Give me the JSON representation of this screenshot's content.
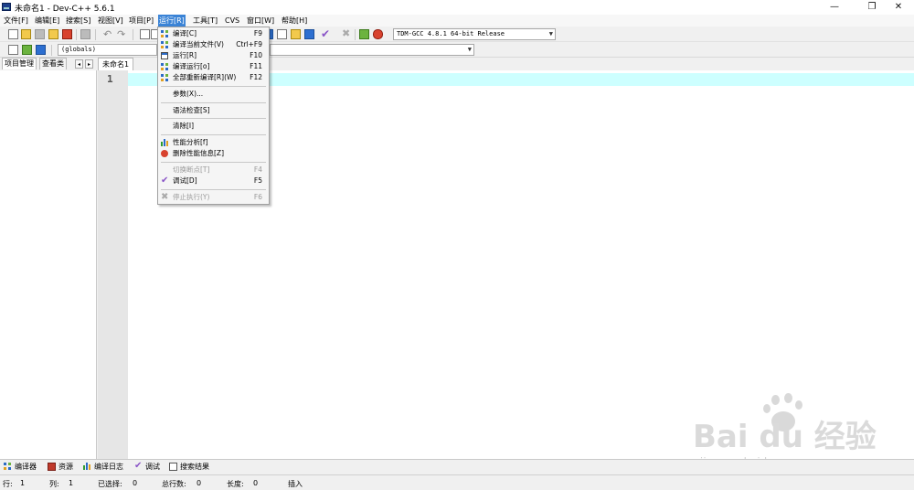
{
  "window": {
    "title": "未命名1 - Dev-C++ 5.6.1",
    "minimize": "—",
    "maximize": "❐",
    "close": "✕"
  },
  "menubar": [
    "文件[F]",
    "编辑[E]",
    "搜索[S]",
    "视图[V]",
    "项目[P]",
    "运行[R]",
    "工具[T]",
    "CVS",
    "窗口[W]",
    "帮助[H]"
  ],
  "toolbar": {
    "compiler_select": "TDM-GCC 4.8.1 64-bit Release",
    "scope_select": "(globals)"
  },
  "left_panel": {
    "tabs": [
      "项目管理",
      "查看类"
    ],
    "prev": "◂",
    "next": "▸"
  },
  "editor": {
    "tab": "未命名1",
    "line_number": "1"
  },
  "run_menu": {
    "items": [
      {
        "label": "编译[C]",
        "shortcut": "F9",
        "icon": "grid-icon",
        "enabled": true
      },
      {
        "label": "编译当前文件(V)",
        "shortcut": "Ctrl+F9",
        "icon": "grid-icon",
        "enabled": true
      },
      {
        "label": "运行[R]",
        "shortcut": "F10",
        "icon": "window-icon",
        "enabled": true
      },
      {
        "label": "编译运行[o]",
        "shortcut": "F11",
        "icon": "window-grid-icon",
        "enabled": true
      },
      {
        "label": "全部重新编译[R](W)",
        "shortcut": "F12",
        "icon": "grid-icon",
        "enabled": true
      },
      {
        "label": "参数(X)...",
        "shortcut": "",
        "icon": "",
        "enabled": true
      },
      {
        "label": "语法检查[S]",
        "shortcut": "",
        "icon": "",
        "enabled": true
      },
      {
        "label": "清除[I]",
        "shortcut": "",
        "icon": "",
        "enabled": true
      },
      {
        "label": "性能分析[f]",
        "shortcut": "",
        "icon": "chart-icon",
        "enabled": true
      },
      {
        "label": "删除性能信息[Z]",
        "shortcut": "",
        "icon": "bug-icon",
        "enabled": true
      },
      {
        "label": "切换断点[T]",
        "shortcut": "F4",
        "icon": "",
        "enabled": false
      },
      {
        "label": "调试[D]",
        "shortcut": "F5",
        "icon": "check-icon",
        "enabled": true
      },
      {
        "label": "停止执行(Y)",
        "shortcut": "F6",
        "icon": "x-icon",
        "enabled": false
      }
    ]
  },
  "bottom_tabs": [
    "编译器",
    "资源",
    "编译日志",
    "调试",
    "搜索结果"
  ],
  "statusbar": {
    "row_label": "行:",
    "row": "1",
    "col_label": "列:",
    "col": "1",
    "sel_label": "已选择:",
    "sel": "0",
    "lines_label": "总行数:",
    "lines": "0",
    "len_label": "长度:",
    "len": "0",
    "mode": "插入"
  },
  "watermark": {
    "text": "Bai du 经验",
    "url": "jingyan.baidu.com"
  },
  "colors": {
    "menu_highlight": "#3a83d6",
    "current_line": "#cdffff",
    "gutter": "#e6e6e6"
  }
}
